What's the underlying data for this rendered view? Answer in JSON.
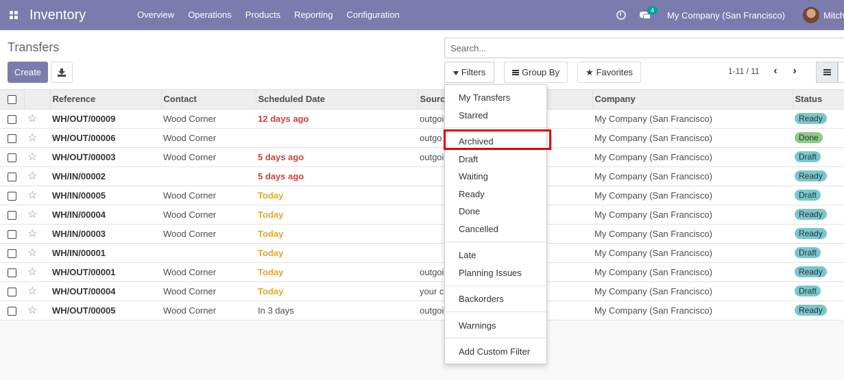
{
  "nav": {
    "app_title": "Inventory",
    "menu": [
      "Overview",
      "Operations",
      "Products",
      "Reporting",
      "Configuration"
    ],
    "messages_count": "4",
    "company": "My Company (San Francisco)",
    "user": "Mitch"
  },
  "control": {
    "title": "Transfers",
    "create_label": "Create",
    "search_placeholder": "Search...",
    "filters_label": "Filters",
    "groupby_label": "Group By",
    "favorites_label": "Favorites",
    "pager": "1-11 / 11"
  },
  "table": {
    "headers": [
      "Reference",
      "Contact",
      "Scheduled Date",
      "Source",
      "Company",
      "Status"
    ],
    "rows": [
      {
        "ref": "WH/OUT/00009",
        "contact": "Wood Corner",
        "date": "12 days ago",
        "date_style": "late",
        "source": "outgoi",
        "company": "My Company (San Francisco)",
        "status": "Ready"
      },
      {
        "ref": "WH/OUT/00006",
        "contact": "Wood Corner",
        "date": "",
        "date_style": "none",
        "source": "outgo",
        "company": "My Company (San Francisco)",
        "status": "Done"
      },
      {
        "ref": "WH/OUT/00003",
        "contact": "Wood Corner",
        "date": "5 days ago",
        "date_style": "late",
        "source": "outgoi",
        "company": "My Company (San Francisco)",
        "status": "Draft"
      },
      {
        "ref": "WH/IN/00002",
        "contact": "",
        "date": "5 days ago",
        "date_style": "late",
        "source": "",
        "company": "My Company (San Francisco)",
        "status": "Ready"
      },
      {
        "ref": "WH/IN/00005",
        "contact": "Wood Corner",
        "date": "Today",
        "date_style": "today",
        "source": "",
        "company": "My Company (San Francisco)",
        "status": "Draft"
      },
      {
        "ref": "WH/IN/00004",
        "contact": "Wood Corner",
        "date": "Today",
        "date_style": "today",
        "source": "",
        "company": "My Company (San Francisco)",
        "status": "Ready"
      },
      {
        "ref": "WH/IN/00003",
        "contact": "Wood Corner",
        "date": "Today",
        "date_style": "today",
        "source": "",
        "company": "My Company (San Francisco)",
        "status": "Ready"
      },
      {
        "ref": "WH/IN/00001",
        "contact": "",
        "date": "Today",
        "date_style": "today",
        "source": "",
        "company": "My Company (San Francisco)",
        "status": "Draft"
      },
      {
        "ref": "WH/OUT/00001",
        "contact": "Wood Corner",
        "date": "Today",
        "date_style": "today",
        "source": "outgoi",
        "company": "My Company (San Francisco)",
        "status": "Ready"
      },
      {
        "ref": "WH/OUT/00004",
        "contact": "Wood Corner",
        "date": "Today",
        "date_style": "today",
        "source": "your c",
        "company": "My Company (San Francisco)",
        "status": "Draft"
      },
      {
        "ref": "WH/OUT/00005",
        "contact": "Wood Corner",
        "date": "In 3 days",
        "date_style": "none",
        "source": "outgoi",
        "company": "My Company (San Francisco)",
        "status": "Ready"
      }
    ]
  },
  "filters_menu": {
    "items": [
      "My Transfers",
      "Starred",
      "Archived",
      "Draft",
      "Waiting",
      "Ready",
      "Done",
      "Cancelled",
      "Late",
      "Planning Issues",
      "Backorders",
      "Warnings",
      "Add Custom Filter"
    ],
    "highlighted": "Archived"
  },
  "colors": {
    "navbar": "#7c7bad",
    "late": "#d23f3a",
    "today": "#e0a631",
    "highlight_border": "#e0000d"
  }
}
